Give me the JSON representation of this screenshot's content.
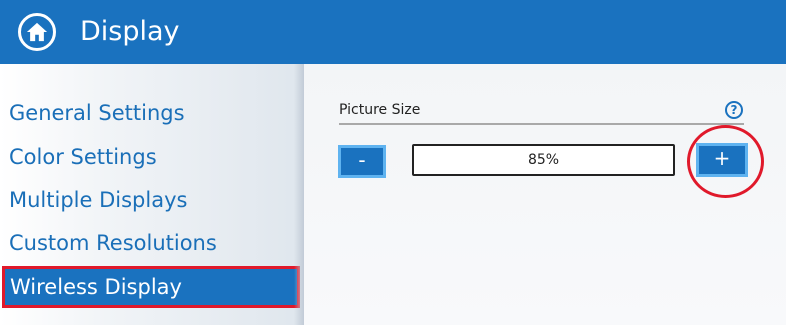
{
  "header": {
    "title": "Display",
    "home_icon": "home-icon"
  },
  "sidebar": {
    "items": [
      {
        "label": "General Settings",
        "active": false
      },
      {
        "label": "Color Settings",
        "active": false
      },
      {
        "label": "Multiple Displays",
        "active": false
      },
      {
        "label": "Custom Resolutions",
        "active": false
      },
      {
        "label": "Wireless Display",
        "active": true
      }
    ]
  },
  "main": {
    "picture_size": {
      "label": "Picture Size",
      "help_glyph": "?",
      "decrease_label": "-",
      "increase_label": "+",
      "value": "85%"
    }
  },
  "colors": {
    "accent": "#1a72bf",
    "button_border": "#5fb3f0",
    "highlight": "#e0192b",
    "nav_text": "#1a6fb8"
  }
}
